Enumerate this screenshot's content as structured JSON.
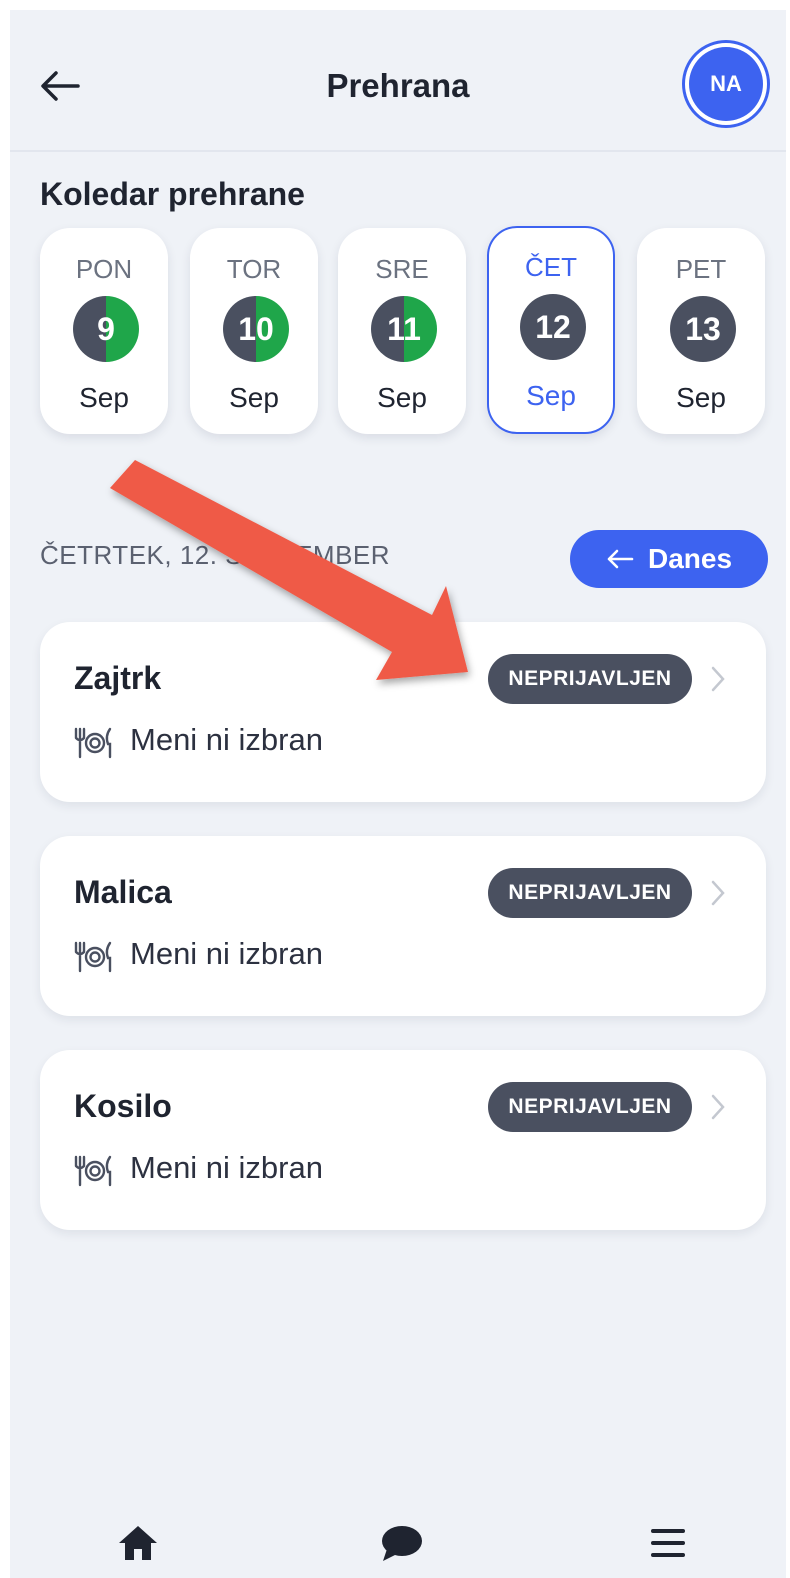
{
  "header": {
    "title": "Prehrana",
    "avatar_initials": "NA"
  },
  "calendar": {
    "title": "Koledar prehrane",
    "days": [
      {
        "name": "PON",
        "num": "9",
        "month": "Sep",
        "status": "partial"
      },
      {
        "name": "TOR",
        "num": "10",
        "month": "Sep",
        "status": "partial"
      },
      {
        "name": "SRE",
        "num": "11",
        "month": "Sep",
        "status": "partial"
      },
      {
        "name": "ČET",
        "num": "12",
        "month": "Sep",
        "status": "selected"
      },
      {
        "name": "PET",
        "num": "13",
        "month": "Sep",
        "status": "none"
      }
    ]
  },
  "date_bar": {
    "label": "ČETRTEK, 12. SEPTEMBER",
    "today_button": "Danes"
  },
  "meals": [
    {
      "title": "Zajtrk",
      "status": "NEPRIJAVLJEN",
      "menu": "Meni ni izbran"
    },
    {
      "title": "Malica",
      "status": "NEPRIJAVLJEN",
      "menu": "Meni ni izbran"
    },
    {
      "title": "Kosilo",
      "status": "NEPRIJAVLJEN",
      "menu": "Meni ni izbran"
    }
  ],
  "nav": {
    "items": [
      "home-icon",
      "chat-icon",
      "menu-icon"
    ]
  },
  "colors": {
    "accent": "#3d63f0",
    "badge": "#4a5060",
    "green": "#1fa64a",
    "annotation_arrow": "#ef5a47"
  }
}
